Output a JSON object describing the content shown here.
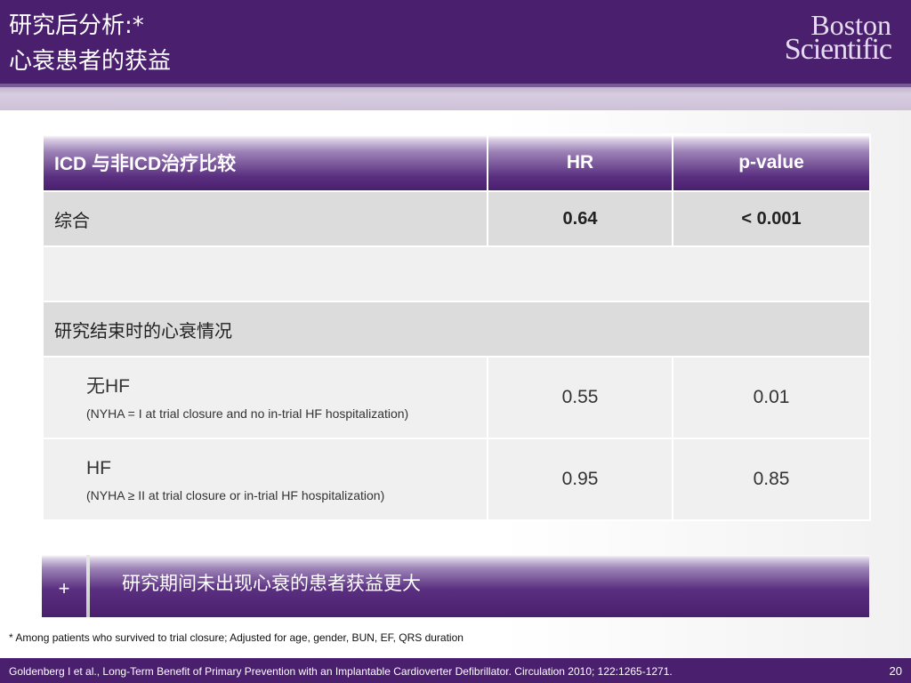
{
  "header": {
    "title_line1": "研究后分析:*",
    "title_line2": "心衰患者的获益",
    "logo_line1": "Boston",
    "logo_line2": "Scientific"
  },
  "table": {
    "columns": [
      "ICD 与非ICD治疗比较",
      "HR",
      "p-value"
    ],
    "rows": [
      {
        "label": "综合",
        "hr": "0.64",
        "p": "< 0.001"
      },
      {
        "label": "",
        "hr": "",
        "p": ""
      },
      {
        "label": "研究结束时的心衰情况",
        "hr": "",
        "p": ""
      },
      {
        "label": "无HF",
        "note": "(NYHA = I at trial closure and no in-trial HF hospitalization)",
        "hr": "0.55",
        "p": "0.01"
      },
      {
        "label": "HF",
        "note": "(NYHA ≥ II at trial closure or in-trial HF hospitalization)",
        "hr": "0.95",
        "p": "0.85"
      }
    ]
  },
  "callout": {
    "symbol": "+",
    "text": "研究期间未出现心衰的患者获益更大"
  },
  "footnote": "* Among patients who survived to trial closure; Adjusted for age, gender, BUN, EF, QRS duration",
  "footer": {
    "reference": "Goldenberg I et al., Long-Term Benefit of Primary Prevention with an Implantable Cardioverter Defibrillator. Circulation 2010; 122:1265-1271.",
    "page_number": "20"
  },
  "colors": {
    "brand_purple": "#4a1f6e",
    "row_gray": "#dcdcdc",
    "row_light": "#f0f0f0"
  }
}
